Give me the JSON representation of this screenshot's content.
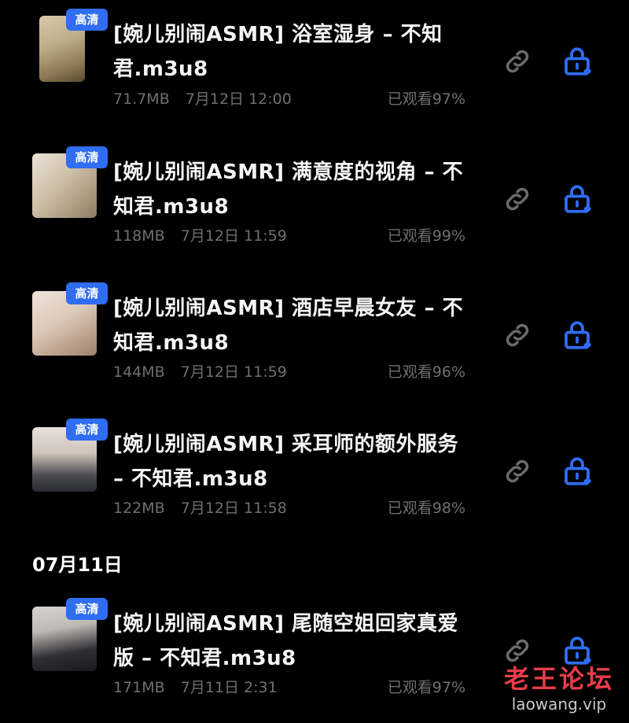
{
  "badge_label": "高清",
  "date_header": "07月11日",
  "items": [
    {
      "title": "[婉儿别闹ASMR] 浴室湿身 – 不知君.m3u8",
      "size": "71.7MB",
      "date": "7月12日 12:00",
      "watched": "已观看97%"
    },
    {
      "title": "[婉儿别闹ASMR] 满意度的视角 – 不知君.m3u8",
      "size": "118MB",
      "date": "7月12日 11:59",
      "watched": "已观看99%"
    },
    {
      "title": "[婉儿别闹ASMR] 酒店早晨女友 – 不知君.m3u8",
      "size": "144MB",
      "date": "7月12日 11:59",
      "watched": "已观看96%"
    },
    {
      "title": "[婉儿别闹ASMR] 采耳师的额外服务 – 不知君.m3u8",
      "size": "122MB",
      "date": "7月12日 11:58",
      "watched": "已观看98%"
    },
    {
      "title": "[婉儿别闹ASMR] 尾随空姐回家真爱版 – 不知君.m3u8",
      "size": "171MB",
      "date": "7月11日 2:31",
      "watched": "已观看97%"
    }
  ],
  "icons": {
    "link": "link-icon",
    "lock": "lock-icon"
  },
  "colors": {
    "accent": "#2f6df3",
    "background": "#000000",
    "muted_text": "#6f6f6f",
    "watermark_red": "#e83d4a"
  },
  "watermark": {
    "cn": "老王论坛",
    "en": "laowang.vip"
  }
}
